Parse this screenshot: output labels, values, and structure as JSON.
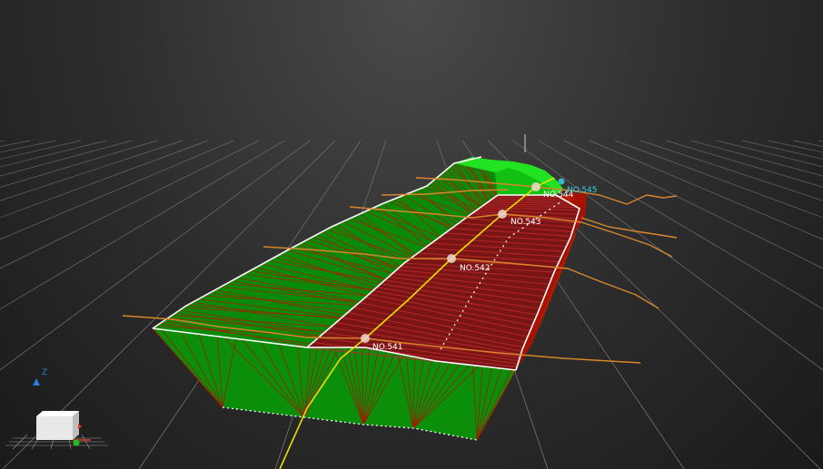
{
  "viewport": {
    "background_top": "#4a4a4a",
    "background_bottom": "#1a1a1a",
    "grid_color": "#cfcfcf"
  },
  "stations": [
    {
      "id": "s541",
      "label": "NO.541"
    },
    {
      "id": "s542",
      "label": "NO.542"
    },
    {
      "id": "s543",
      "label": "NO.543"
    },
    {
      "id": "s544",
      "label": "NO.544"
    },
    {
      "id": "s545",
      "label": "NO.545"
    }
  ],
  "colors": {
    "cut_slope": "#0a8a0a",
    "fill_slope": "#9a1200",
    "road_surface": "#7a1515",
    "centerline": "#e8e000",
    "cross_section_line": "#d8862c",
    "station_marker": "#f0d8d0",
    "station_label": "#ffffff",
    "end_label": "#35d0e6"
  },
  "axis_indicator": {
    "z_label": "Z",
    "z_color": "#2b7be0",
    "x_color": "#e03a2a",
    "y_color": "#20c020",
    "cube_color": "#e8e8e8"
  }
}
